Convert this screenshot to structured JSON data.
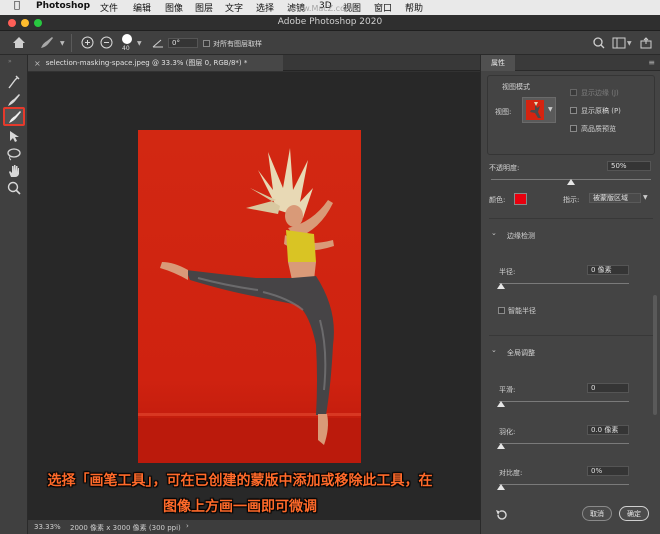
{
  "menubar": {
    "app_name": "Photoshop",
    "items": [
      "文件",
      "编辑",
      "图像",
      "图层",
      "文字",
      "选择",
      "滤镜",
      "3D",
      "视图",
      "窗口",
      "帮助"
    ],
    "watermark": "www.MacZ.com"
  },
  "titlebar": {
    "title": "Adobe Photoshop 2020"
  },
  "options": {
    "brush_size": "40",
    "angle": "0°",
    "sample_all_layers": "对所有图层取样"
  },
  "document": {
    "tab_label": "selection-masking-space.jpeg @ 33.3% (图层 0, RGB/8*) *",
    "zoom": "33.33%",
    "info": "2000 像素 x 3000 像素 (300 ppi)"
  },
  "panel": {
    "tab": "属性",
    "view_mode_title": "视图模式",
    "view_label": "视图:",
    "show_edges": "显示边缘 (J)",
    "show_original": "显示原稿 (P)",
    "high_quality": "高品质预览",
    "opacity_label": "不透明度:",
    "opacity_value": "50%",
    "opacity_level": 0.5,
    "color_label": "颜色:",
    "color_swatch": "#e8000e",
    "indicate_label": "指示:",
    "indicate_value": "被蒙版区域",
    "edge_detect_title": "边缘检测",
    "radius_label": "半径:",
    "radius_value": "0 像素",
    "smart_radius": "智能半径",
    "global_title": "全局调整",
    "smooth_label": "平滑:",
    "smooth_value": "0",
    "feather_label": "羽化:",
    "feather_value": "0.0 像素",
    "contrast_label": "对比度:",
    "contrast_value": "0%",
    "cancel": "取消",
    "ok": "确定"
  },
  "caption": {
    "line1": "选择「画笔工具」，可在已创建的蒙版中添加或移除此工具，在",
    "line2": "图像上方画一画即可微调"
  },
  "colors": {
    "accent_highlight": "#e53a2c",
    "photo_bg": "#d52410"
  }
}
